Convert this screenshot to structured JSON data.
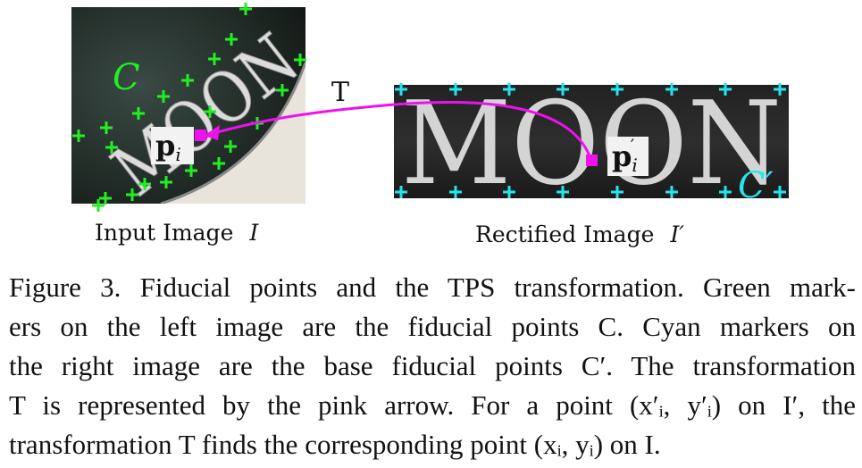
{
  "figure": {
    "left_image": {
      "word": "MOON",
      "set_label": "C",
      "point_label_base": "p",
      "point_label_sub": "i",
      "caption_text": "Input Image",
      "caption_symbol": "I"
    },
    "right_image": {
      "word": "MOON",
      "set_label": "C′",
      "point_label_base": "p",
      "point_label_sub": "i",
      "point_label_prime": "′",
      "caption_text": "Rectified Image",
      "caption_symbol": "I′"
    },
    "arrow_label": "T",
    "colors": {
      "green_marker": "#22ee22",
      "cyan_marker": "#22e5f0",
      "pink_arrow": "#ee11ee",
      "point_box": "#f2f2f2"
    }
  },
  "caption": {
    "lines": [
      "Figure 3. Fiducial points and the TPS transformation. Green mark-",
      "ers on the left image are the fiducial points C. Cyan markers on",
      "the right image are the base fiducial points C′. The transformation",
      "T is represented by the pink arrow. For a point (x′ᵢ, y′ᵢ) on I′, the",
      "transformation T finds the corresponding point (xᵢ, yᵢ) on I."
    ]
  }
}
